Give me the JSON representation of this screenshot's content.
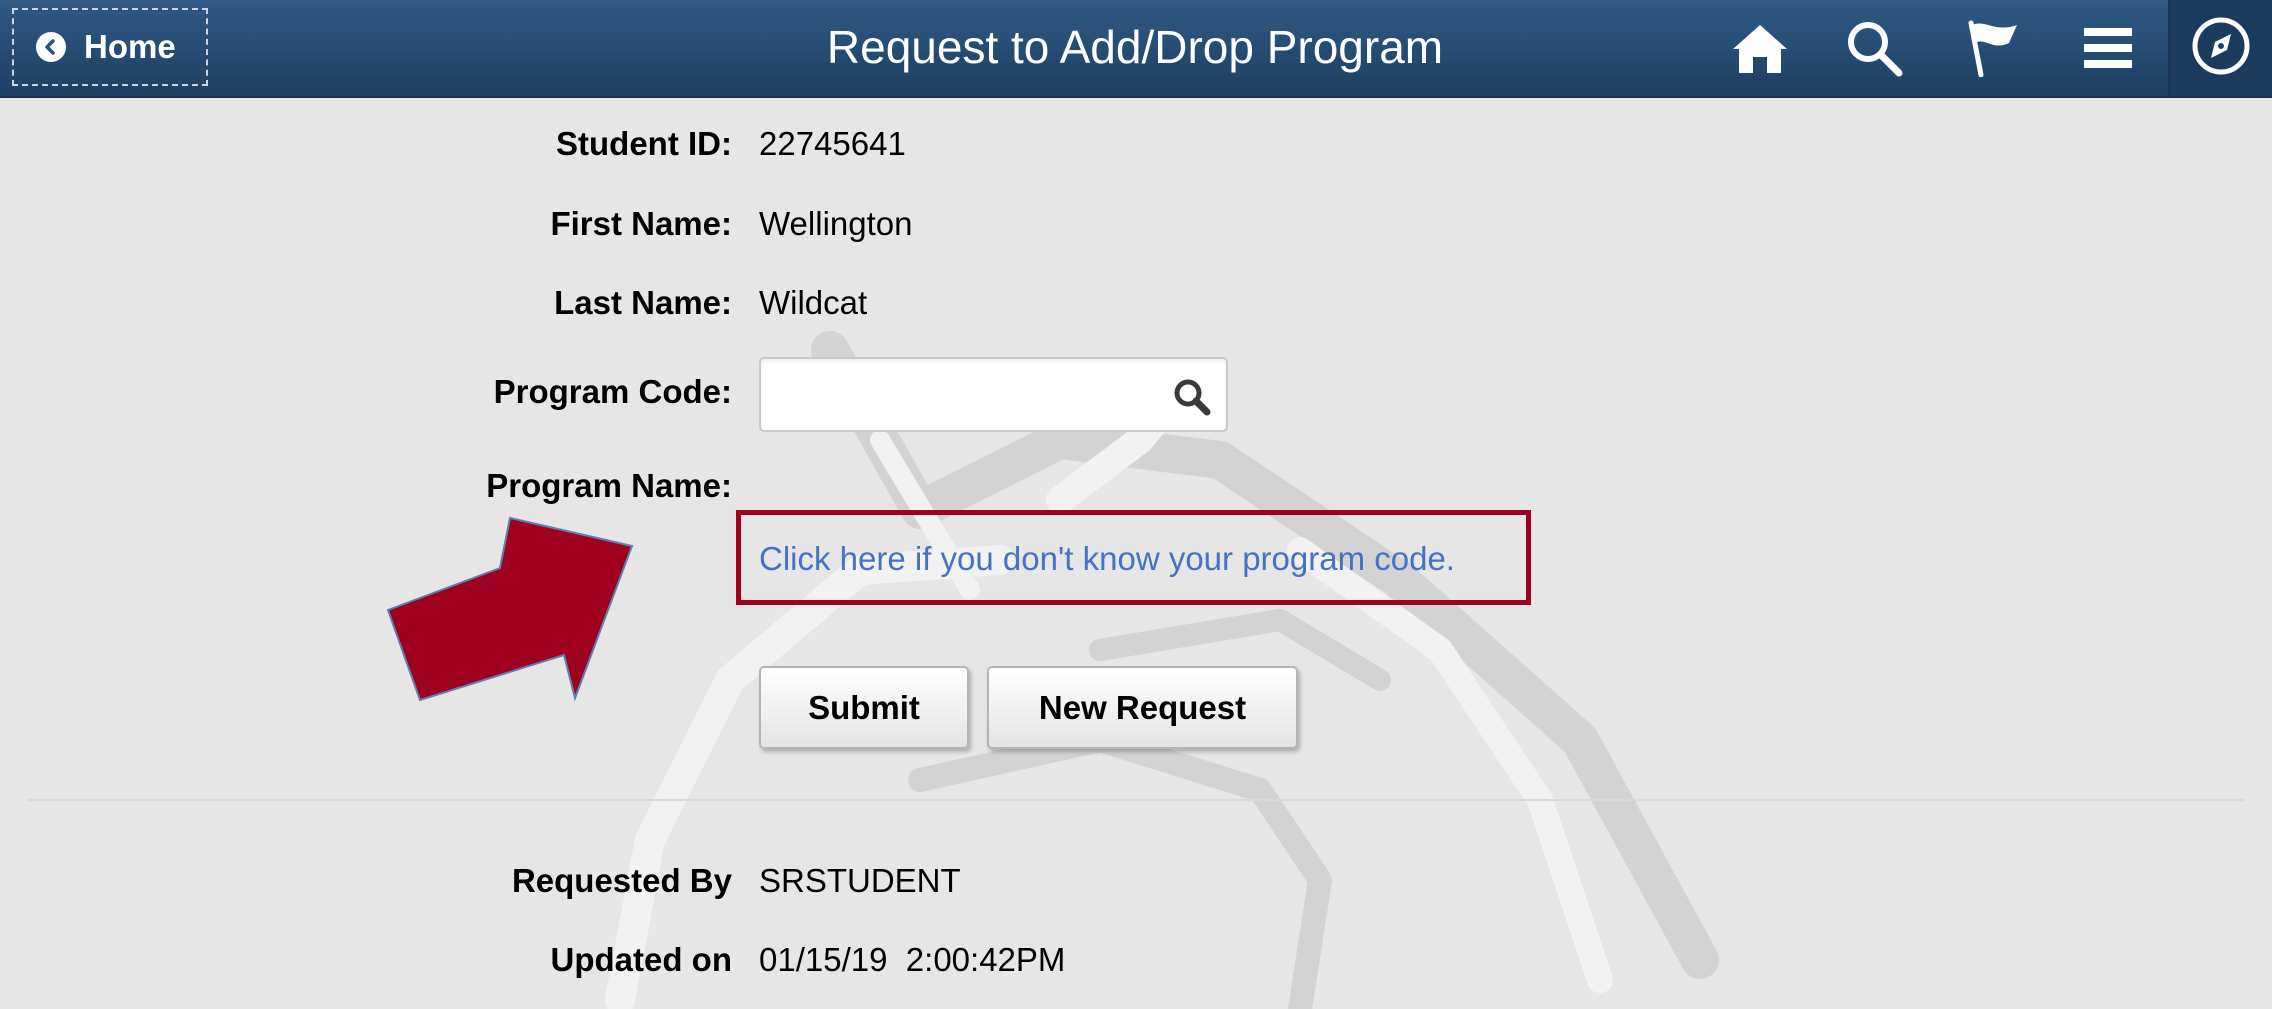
{
  "header": {
    "back_label": "Home",
    "title": "Request to Add/Drop Program",
    "icons": [
      "home-icon",
      "search-icon",
      "flag-icon",
      "menu-icon",
      "compass-icon"
    ]
  },
  "form": {
    "student_id_label": "Student ID:",
    "student_id": "22745641",
    "first_name_label": "First Name:",
    "first_name": "Wellington",
    "last_name_label": "Last Name:",
    "last_name": "Wildcat",
    "program_code_label": "Program Code:",
    "program_code_value": "",
    "program_name_label": "Program Name:",
    "program_name": "",
    "lookup_link": "Click here if you don't know your program code."
  },
  "buttons": {
    "submit": "Submit",
    "new_request": "New Request"
  },
  "footer": {
    "requested_by_label": "Requested By",
    "requested_by": "SRSTUDENT",
    "updated_on_label": "Updated on",
    "updated_on": "01/15/19  2:00:42PM"
  },
  "colors": {
    "header": "#1d3f63",
    "highlight": "#a0001f",
    "link": "#4472c4",
    "background": "#e6e6e6"
  }
}
